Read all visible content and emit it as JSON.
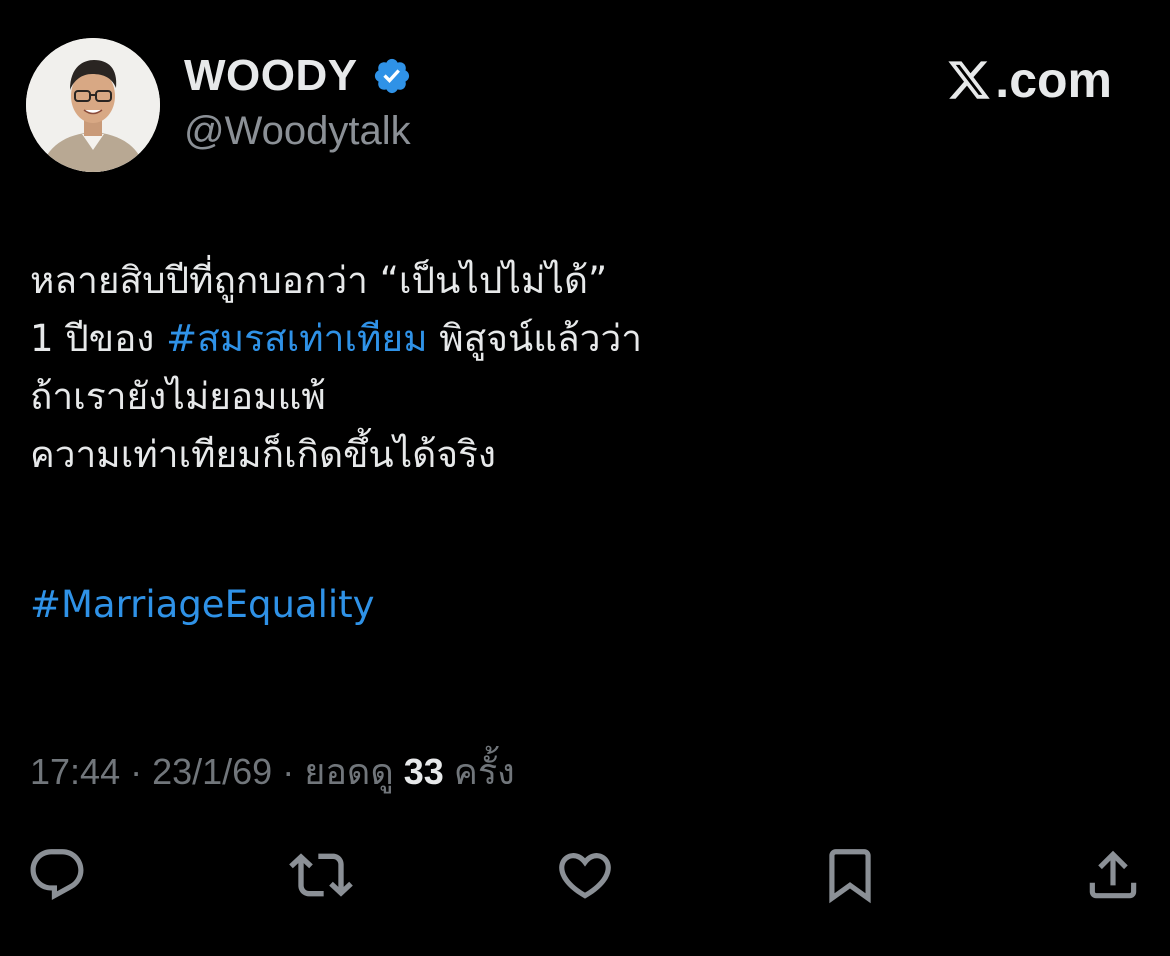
{
  "author": {
    "display_name": "WOODY",
    "handle": "@Woodytalk",
    "verified": true,
    "verified_icon": "verified-badge-icon",
    "verified_color": "#2f92e7",
    "avatar_icon": "profile-photo-avatar"
  },
  "brand": {
    "logo_icon": "x-logo-icon",
    "domain_text": ".com"
  },
  "tweet": {
    "line1": "หลายสิบปีที่ถูกบอกว่า “เป็นไปไม่ได้”",
    "line2_prefix": "1 ปีของ ",
    "line2_hashtag": "#สมรสเท่าเทียม",
    "line2_suffix": " พิสูจน์แล้วว่า",
    "line3": "ถ้าเรายังไม่ยอมแพ้",
    "line4": "ความเท่าเทียมก็เกิดขึ้นได้จริง",
    "hashtag2": "#MarriageEquality",
    "hashtag_color": "#2f92e7"
  },
  "meta": {
    "time": "17:44",
    "separator": " · ",
    "date": "23/1/69",
    "views_label": "ยอดดู ",
    "views_count": "33",
    "views_unit": " ครั้ง"
  },
  "actions": [
    {
      "icon": "reply-icon"
    },
    {
      "icon": "retweet-icon"
    },
    {
      "icon": "like-heart-icon"
    },
    {
      "icon": "bookmark-icon"
    },
    {
      "icon": "share-icon"
    }
  ],
  "colors": {
    "background": "#000000",
    "text_primary": "#e7e9ea",
    "text_secondary": "#71767b",
    "icon_color": "#8b9096",
    "link": "#2f92e7"
  }
}
